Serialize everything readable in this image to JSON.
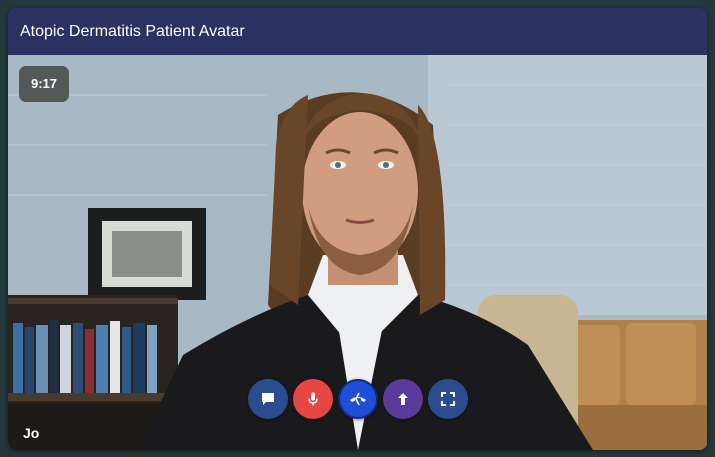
{
  "header": {
    "title": "Atopic Dermatitis Patient Avatar"
  },
  "video": {
    "timer": "9:17",
    "participant_name": "Jo"
  },
  "controls": {
    "items": [
      {
        "name": "chat-button",
        "icon": "chat-icon",
        "color": "#2b4d8f"
      },
      {
        "name": "microphone-button",
        "icon": "microphone-icon",
        "color": "#e84545"
      },
      {
        "name": "end-call-button",
        "icon": "hang-up-icon",
        "color": "#1f4fd8"
      },
      {
        "name": "upload-button",
        "icon": "arrow-up-icon",
        "color": "#5a3a9a"
      },
      {
        "name": "fullscreen-button",
        "icon": "fullscreen-icon",
        "color": "#2b4d8f"
      }
    ]
  }
}
